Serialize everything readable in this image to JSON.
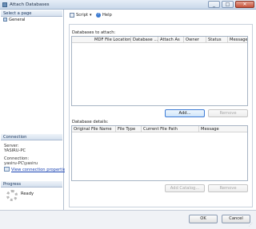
{
  "window": {
    "title": "Attach Databases",
    "controls": [
      "_",
      "□",
      "✕"
    ]
  },
  "left_pane": {
    "select_page_header": "Select a page",
    "pages": [
      {
        "label": "General"
      }
    ],
    "connection_header": "Connection",
    "server_label": "Server:",
    "server_value": "YASIRU-PC",
    "connection_label": "Connection:",
    "connection_value": "yasiru-PC\\yasiru",
    "view_connection_link": "View connection properties",
    "progress_header": "Progress",
    "progress_status": "Ready"
  },
  "toolbar": {
    "script_label": "Script",
    "script_dropdown_arrow": "▾",
    "help_label": "Help",
    "help_glyph": "?"
  },
  "attach_section": {
    "label": "Databases to attach:",
    "columns": [
      "MDF File Location",
      "Database ...",
      "Attach As",
      "Owner",
      "Status",
      "Message"
    ],
    "rows": [],
    "add_button": "Add...",
    "remove_button": "Remove"
  },
  "details_section": {
    "label": "Database details:",
    "columns": [
      "Original File Name",
      "File Type",
      "Current File Path",
      "Message"
    ],
    "rows": [],
    "add_catalog_button": "Add Catalog...",
    "remove_button": "Remove"
  },
  "footer": {
    "ok_button": "OK",
    "cancel_button": "Cancel"
  },
  "colors": {
    "section_header_text": "#15335c",
    "link": "#1a43b3",
    "default_button_border": "#3d7bd6"
  }
}
